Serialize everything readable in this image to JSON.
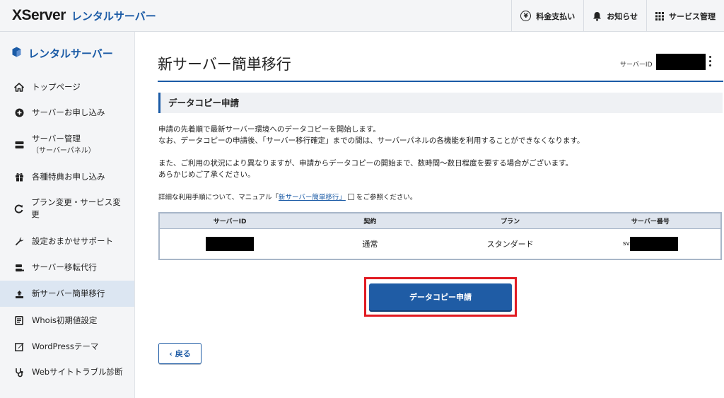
{
  "header": {
    "brand": "XServer",
    "brand_sub": "レンタルサーバー",
    "actions": [
      {
        "label": "料金支払い",
        "icon": "yen-icon"
      },
      {
        "label": "お知らせ",
        "icon": "bell-icon"
      },
      {
        "label": "サービス管理",
        "icon": "grid-icon"
      }
    ]
  },
  "sidebar": {
    "heading": "レンタルサーバー",
    "items": [
      {
        "label": "トップページ",
        "icon": "home-icon"
      },
      {
        "label": "サーバーお申し込み",
        "icon": "plus-circle-icon"
      },
      {
        "label": "サーバー管理",
        "sub": "（サーバーパネル）",
        "icon": "server-icon"
      },
      {
        "label": "各種特典お申し込み",
        "icon": "gift-icon"
      },
      {
        "label": "プラン変更・サービス変更",
        "icon": "refresh-icon"
      },
      {
        "label": "設定おまかせサポート",
        "icon": "wrench-icon"
      },
      {
        "label": "サーバー移転代行",
        "icon": "server-move-icon"
      },
      {
        "label": "新サーバー簡単移行",
        "icon": "upload-icon",
        "active": true
      },
      {
        "label": "Whois初期値設定",
        "icon": "document-icon"
      },
      {
        "label": "WordPressテーマ",
        "icon": "edit-icon"
      },
      {
        "label": "Webサイトトラブル診断",
        "icon": "stethoscope-icon"
      }
    ]
  },
  "main": {
    "title": "新サーバー簡単移行",
    "server_id_label": "サーバーID",
    "section_title": "データコピー申請",
    "para1_line1": "申請の先着順で最新サーバー環境へのデータコピーを開始します。",
    "para1_line2": "なお、データコピーの申請後、「サーバー移行確定」までの間は、サーバーパネルの各機能を利用することができなくなります。",
    "para2_line1": "また、ご利用の状況により異なりますが、申請からデータコピーの開始まで、数時間～数日程度を要する場合がございます。",
    "para2_line2": "あらかじめご了承ください。",
    "note_prefix": "詳細な利用手順について、マニュアル「",
    "note_link": "新サーバー簡単移行」",
    "note_suffix": "をご参照ください。",
    "table": {
      "headers": [
        "サーバーID",
        "契約",
        "プラン",
        "サーバー番号"
      ],
      "row": {
        "contract": "通常",
        "plan": "スタンダード",
        "server_no_prefix": "sv"
      }
    },
    "primary_button": "データコピー申請",
    "back_button": "戻る"
  }
}
